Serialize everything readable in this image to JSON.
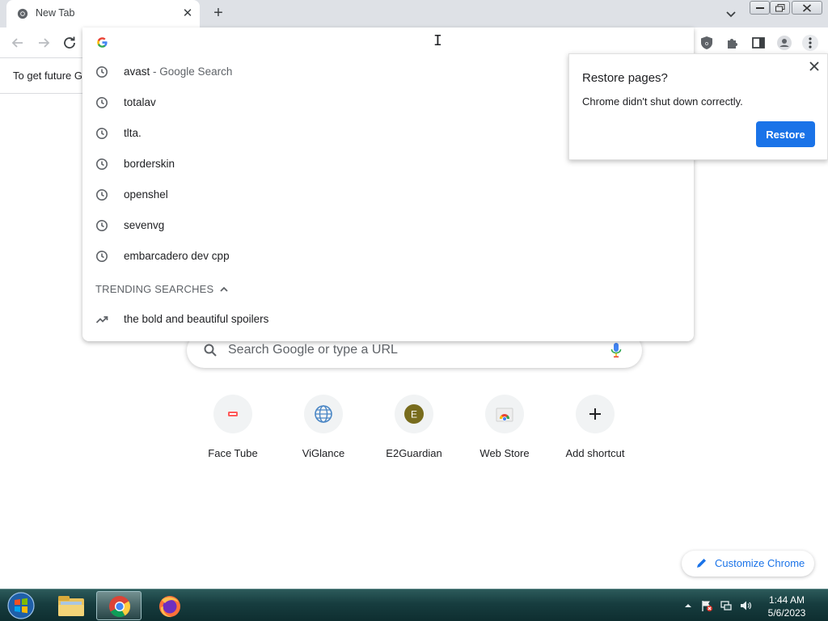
{
  "tab": {
    "title": "New Tab",
    "favicon_icon": "chrome-icon",
    "close_icon": "close-icon"
  },
  "new_tab_button": {
    "icon": "plus-icon"
  },
  "infobar": {
    "text": "To get future G"
  },
  "omnibox": {
    "value": "",
    "suggestions": [
      {
        "text": "avast",
        "sub": " - Google Search",
        "icon": "history-icon"
      },
      {
        "text": "totalav",
        "sub": "",
        "icon": "history-icon"
      },
      {
        "text": "tlta.",
        "sub": "",
        "icon": "history-icon"
      },
      {
        "text": "borderskin",
        "sub": "",
        "icon": "history-icon"
      },
      {
        "text": "openshel",
        "sub": "",
        "icon": "history-icon"
      },
      {
        "text": "sevenvg",
        "sub": "",
        "icon": "history-icon"
      },
      {
        "text": "embarcadero dev cpp",
        "sub": "",
        "icon": "history-icon"
      }
    ],
    "trending_header": "TRENDING SEARCHES",
    "trending": [
      {
        "text": "the bold and beautiful spoilers",
        "icon": "trending-icon"
      }
    ]
  },
  "ntp": {
    "search_placeholder": "Search Google or type a URL",
    "shortcuts": [
      {
        "label": "Face Tube",
        "icon": "facetube-icon"
      },
      {
        "label": "ViGlance",
        "icon": "globe-icon"
      },
      {
        "label": "E2Guardian",
        "icon": "letter-avatar-icon",
        "letter": "E"
      },
      {
        "label": "Web Store",
        "icon": "webstore-icon"
      },
      {
        "label": "Add shortcut",
        "icon": "plus-icon"
      }
    ],
    "customize_label": "Customize Chrome"
  },
  "restore_bubble": {
    "title": "Restore pages?",
    "message": "Chrome didn't shut down correctly.",
    "button": "Restore"
  },
  "taskbar": {
    "items": [
      "start-orb-icon",
      "file-explorer-icon",
      "chrome-icon",
      "firefox-icon"
    ],
    "time": "1:44 AM",
    "date": "5/6/2023"
  },
  "colors": {
    "accent": "#1a73e8",
    "tabstrip": "#dee1e6",
    "taskbar": "#173d3f"
  }
}
